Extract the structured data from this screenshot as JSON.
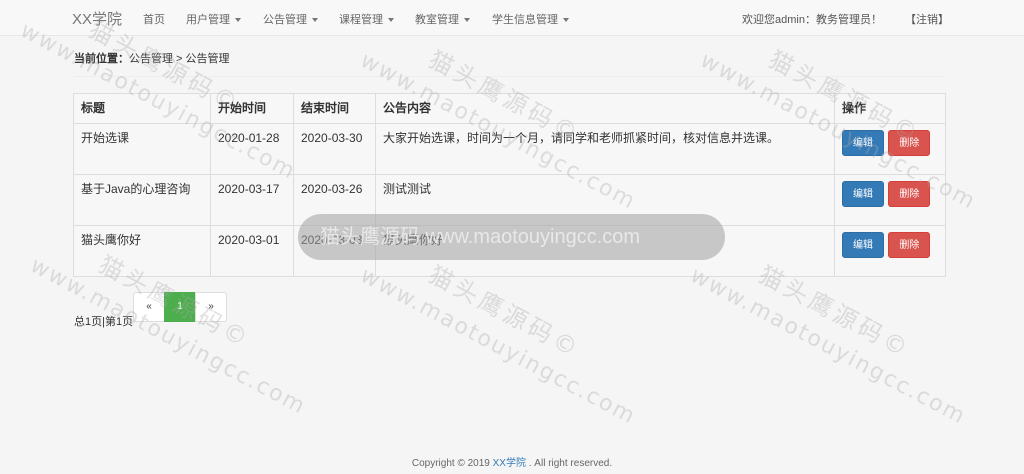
{
  "navbar": {
    "brand": "XX学院",
    "items": [
      {
        "label": "首页",
        "dropdown": false
      },
      {
        "label": "用户管理",
        "dropdown": true
      },
      {
        "label": "公告管理",
        "dropdown": true
      },
      {
        "label": "课程管理",
        "dropdown": true
      },
      {
        "label": "教室管理",
        "dropdown": true
      },
      {
        "label": "学生信息管理",
        "dropdown": true
      }
    ],
    "welcome": "欢迎您admin：教务管理员！",
    "logout": "【注销】"
  },
  "breadcrumb": {
    "lead": "当前位置：",
    "path": "公告管理 > 公告管理"
  },
  "table": {
    "headers": [
      "标题",
      "开始时间",
      "结束时间",
      "公告内容",
      "操作"
    ],
    "rows": [
      {
        "title": "开始选课",
        "start": "2020-01-28",
        "end": "2020-03-30",
        "content": "大家开始选课，时间为一个月，请同学和老师抓紧时间，核对信息并选课。"
      },
      {
        "title": "基于Java的心理咨询",
        "start": "2020-03-17",
        "end": "2020-03-26",
        "content": "测试测试"
      },
      {
        "title": "猫头鹰你好",
        "start": "2020-03-01",
        "end": "2020-03-03",
        "content": "猫头鹰你好"
      }
    ],
    "edit_label": "编辑",
    "delete_label": "删除"
  },
  "pagination": {
    "info": "总1页|第1页",
    "prev": "«",
    "current": "1",
    "next": "»"
  },
  "footer": {
    "prefix": "Copyright © 2019 ",
    "link": "XX学院",
    "suffix": " . All right reserved."
  },
  "watermark": {
    "cn": "猫头鹰源码©",
    "url": "www.maotouyingcc.com",
    "toast": "猫头鹰源码 www.maotouyingcc.com"
  },
  "colors": {
    "edit": "#337ab7",
    "delete": "#d9534f",
    "page_active": "#4cae4c"
  }
}
